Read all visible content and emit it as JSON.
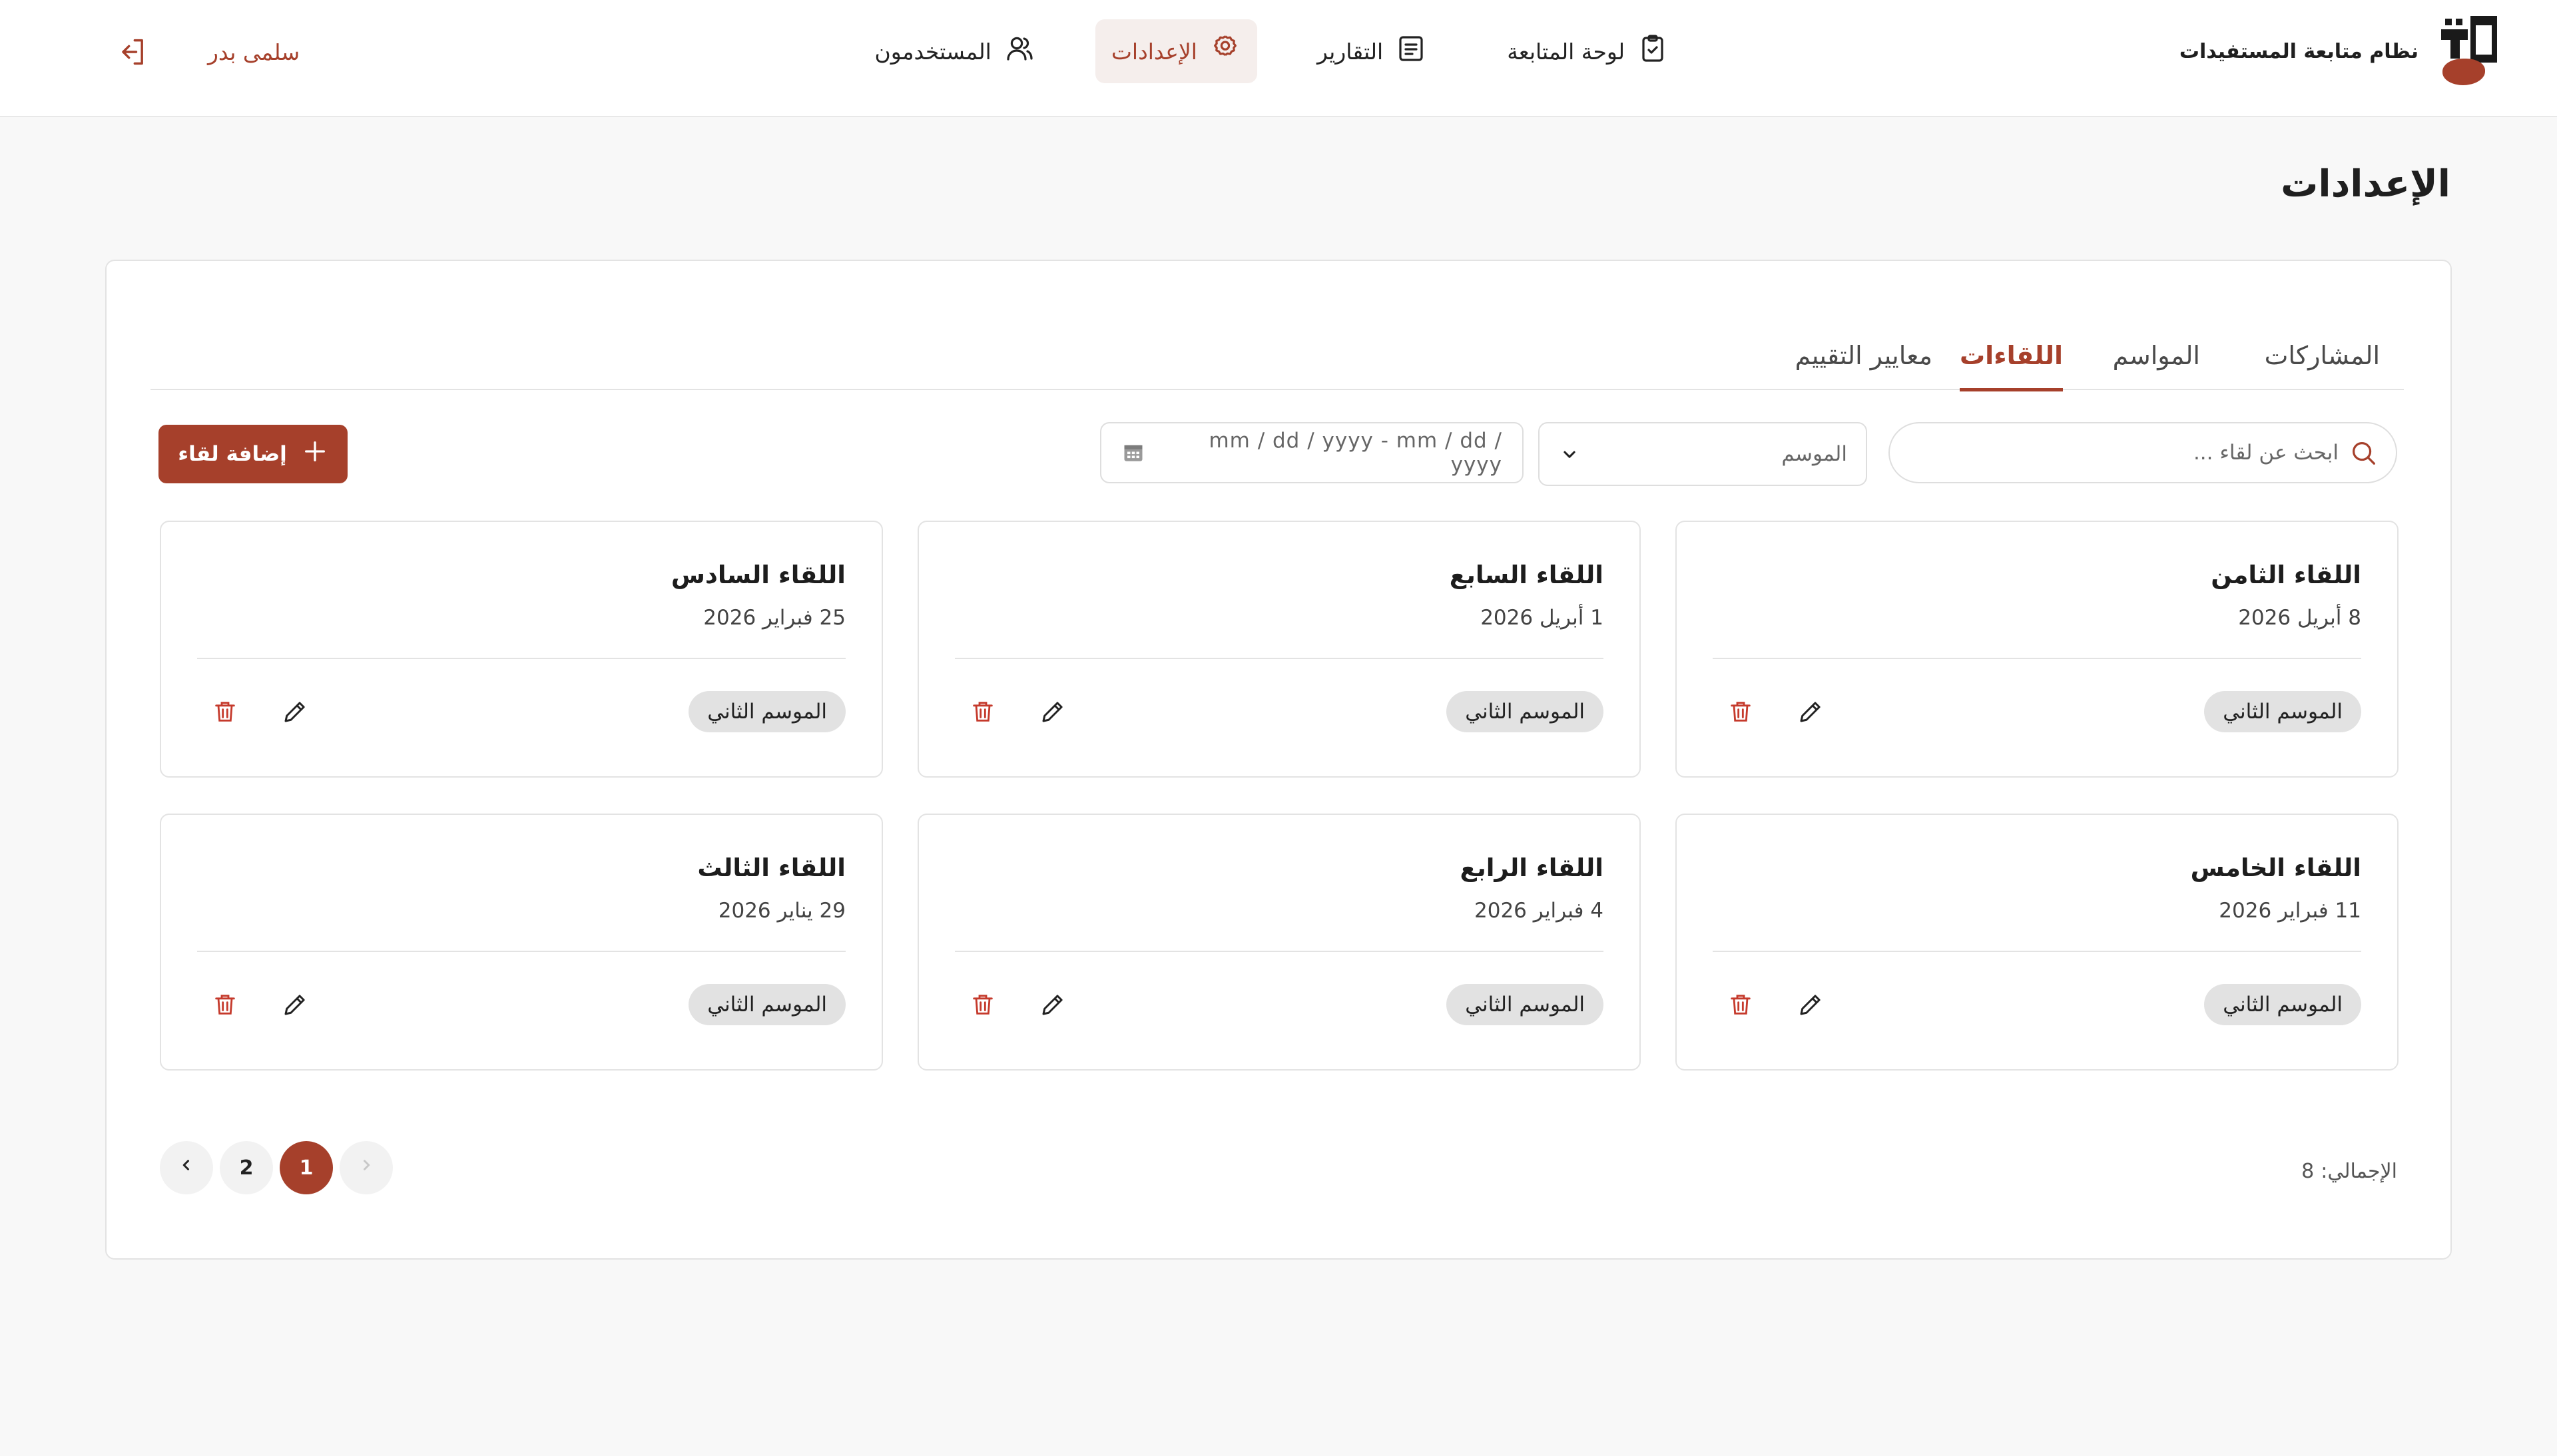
{
  "app": {
    "title": "نظام متابعة المستفيدات",
    "logo_text": "تاء"
  },
  "nav": {
    "items": [
      {
        "label": "لوحة المتابعة",
        "icon": "clipboard-check-icon",
        "active": false
      },
      {
        "label": "التقارير",
        "icon": "report-list-icon",
        "active": false
      },
      {
        "label": "الإعدادات",
        "icon": "gear-icon",
        "active": true
      },
      {
        "label": "المستخدمون",
        "icon": "users-icon",
        "active": false
      }
    ]
  },
  "user": {
    "name": "سلمى بدر",
    "logout_icon": "logout-icon"
  },
  "page": {
    "title": "الإعدادات"
  },
  "tabs": [
    {
      "label": "المشاركات",
      "active": false
    },
    {
      "label": "المواسم",
      "active": false
    },
    {
      "label": "اللقاءات",
      "active": true
    },
    {
      "label": "معايير التقييم",
      "active": false
    }
  ],
  "toolbar": {
    "search_placeholder": "ابحث عن لقاء ...",
    "season_select_value": "الموسم",
    "date_range_placeholder": "mm / dd / yyyy - mm / dd / yyyy",
    "add_label": "إضافة لقاء"
  },
  "meetings": [
    {
      "title": "اللقاء الثامن",
      "date": "8 أبريل 2026",
      "season": "الموسم الثاني"
    },
    {
      "title": "اللقاء السابع",
      "date": "1 أبريل 2026",
      "season": "الموسم الثاني"
    },
    {
      "title": "اللقاء السادس",
      "date": "25 فبراير 2026",
      "season": "الموسم الثاني"
    },
    {
      "title": "اللقاء الخامس",
      "date": "11 فبراير 2026",
      "season": "الموسم الثاني"
    },
    {
      "title": "اللقاء الرابع",
      "date": "4 فبراير 2026",
      "season": "الموسم الثاني"
    },
    {
      "title": "اللقاء الثالث",
      "date": "29 يناير 2026",
      "season": "الموسم الثاني"
    }
  ],
  "footer": {
    "total_label": "الإجمالي:",
    "total_value": "8",
    "pages": [
      "1",
      "2"
    ],
    "current_page": "1"
  },
  "colors": {
    "accent": "#a6402b",
    "accent_bg": "#f5eeec",
    "badge_bg": "#e2e2e2"
  }
}
